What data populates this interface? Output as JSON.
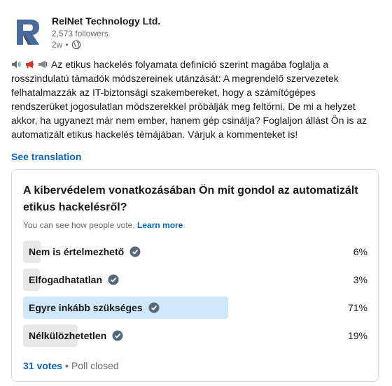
{
  "header": {
    "company_name": "RelNet Technology Ltd.",
    "followers": "2,573 followers",
    "time": "2w",
    "bullet": "•",
    "logo_letter": "R",
    "logo_color": "#4a6a9b"
  },
  "post": {
    "emojis": [
      "speaker-icon",
      "megaphone-icon",
      "loudspeaker-icon"
    ],
    "text": "Az etikus hackelés folyamata definíció szerint magába foglalja a rosszindulatú támadók módszereinek utánzását: A megrendelő szervezetek felhatalmazzák az IT-biztonsági szakembereket, hogy a számítógépes rendszerüket jogosulatlan módszerekkel próbálják meg feltörni. De mi a helyzet akkor, ha ugyanezt már nem ember, hanem gép csinálja? Foglaljon állást Ön is az automatizált etikus hackelés témájában. Várjuk a kommenteket is!",
    "see_translation": "See translation"
  },
  "poll": {
    "question": "A kibervédelem vonatkozásában Ön mit gondol az automatizált etikus hackelésről?",
    "note": "You can see how people vote.",
    "learn_more": "Learn more",
    "options": [
      {
        "label": "Nem is értelmezhető",
        "percent_text": "6%",
        "fraction": 0.06,
        "selected": false
      },
      {
        "label": "Elfogadhatatlan",
        "percent_text": "3%",
        "fraction": 0.03,
        "selected": false
      },
      {
        "label": "Egyre inkább szükséges",
        "percent_text": "71%",
        "fraction": 0.71,
        "selected": true
      },
      {
        "label": "Nélkülözhetetlen",
        "percent_text": "19%",
        "fraction": 0.19,
        "selected": false
      }
    ],
    "votes": "31 votes",
    "separator": "•",
    "status": "Poll closed"
  },
  "colors": {
    "accent": "#0a66c2",
    "bar_default": "#e8e8e8",
    "bar_selected": "#d0e8fb",
    "check": "#56687a"
  }
}
